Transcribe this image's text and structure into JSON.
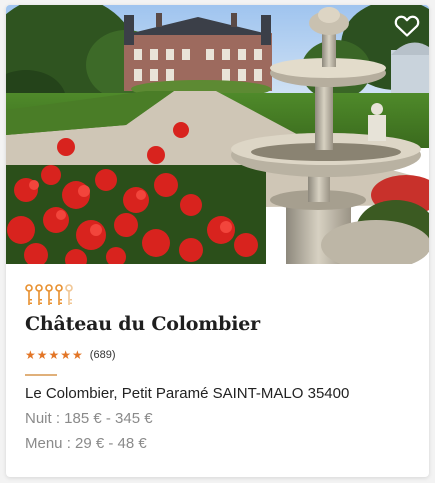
{
  "hotel": {
    "name": "Château du Colombier",
    "stars_glyphs": "★★★★★",
    "reviews": "(689)",
    "address": "Le Colombier, Petit Paramé SAINT-MALO 35400",
    "night_price": "Nuit : 185 € - 345 €",
    "menu_price": "Menu : 29 € - 48 €",
    "keys_filled": 4,
    "keys_total": 5
  },
  "icons": {
    "favorite": "heart-outline-icon",
    "key": "key-icon"
  },
  "colors": {
    "accent": "#e27526",
    "key_filled": "#e8902f",
    "key_empty": "#f1c795",
    "title": "#1f1f1f",
    "muted": "#8a8a8a"
  }
}
